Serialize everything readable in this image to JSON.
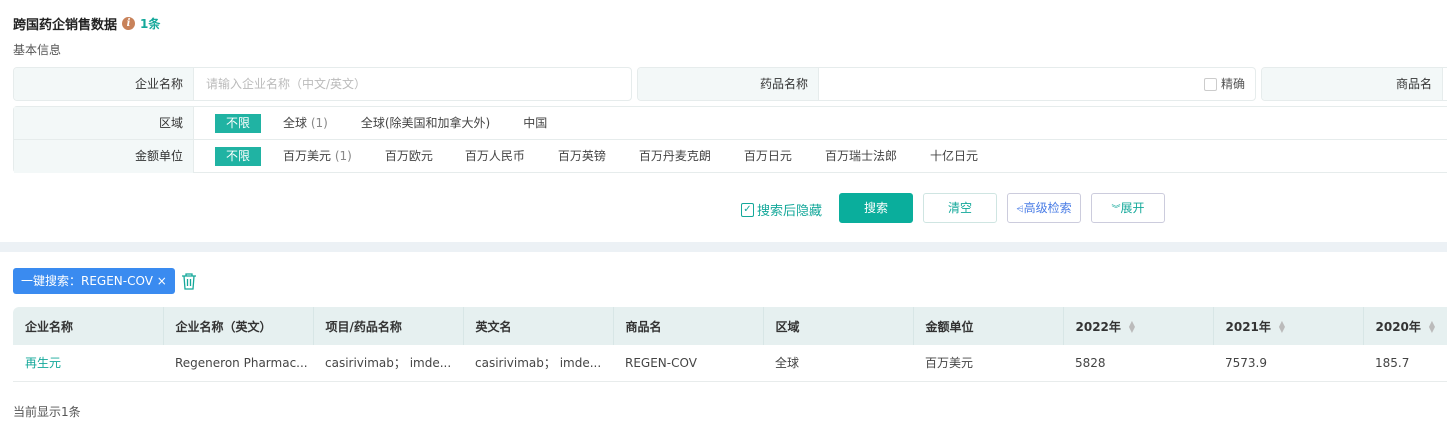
{
  "header": {
    "title": "跨国药企销售数据",
    "info_icon": "i",
    "count": "1条"
  },
  "section": "基本信息",
  "fields": {
    "company_label": "企业名称",
    "company_placeholder": "请输入企业名称（中文/英文）",
    "drug_label": "药品名称",
    "exact_label": "精确",
    "brand_label": "商品名"
  },
  "filters": {
    "region": {
      "label": "区域",
      "options": [
        "不限",
        "全球",
        "全球(除美国和加拿大外)",
        "中国"
      ],
      "counts": {
        "1": "(1)"
      }
    },
    "unit": {
      "label": "金额单位",
      "options": [
        "不限",
        "百万美元",
        "百万欧元",
        "百万人民币",
        "百万英镑",
        "百万丹麦克朗",
        "百万日元",
        "百万瑞士法郎",
        "十亿日元"
      ],
      "counts": {
        "1": "(1)"
      }
    }
  },
  "actions": {
    "hide_after_search": "搜索后隐藏",
    "search": "搜索",
    "clear": "清空",
    "advanced": "高级检索",
    "expand": "展开"
  },
  "chip": {
    "label": "一键搜索：REGEN-COV",
    "close": "×"
  },
  "table": {
    "headers": [
      "企业名称",
      "企业名称（英文）",
      "项目/药品名称",
      "英文名",
      "商品名",
      "区域",
      "金额单位",
      "2022年",
      "2021年",
      "2020年"
    ],
    "rows": [
      [
        "再生元",
        "Regeneron Pharmac...",
        "casirivimab； imde...",
        "casirivimab； imde...",
        "REGEN-COV",
        "全球",
        "百万美元",
        "5828",
        "7573.9",
        "185.7"
      ]
    ]
  },
  "footer": "当前显示1条",
  "colors": {
    "accent": "#14a89a",
    "chip": "#3a8bf0"
  }
}
